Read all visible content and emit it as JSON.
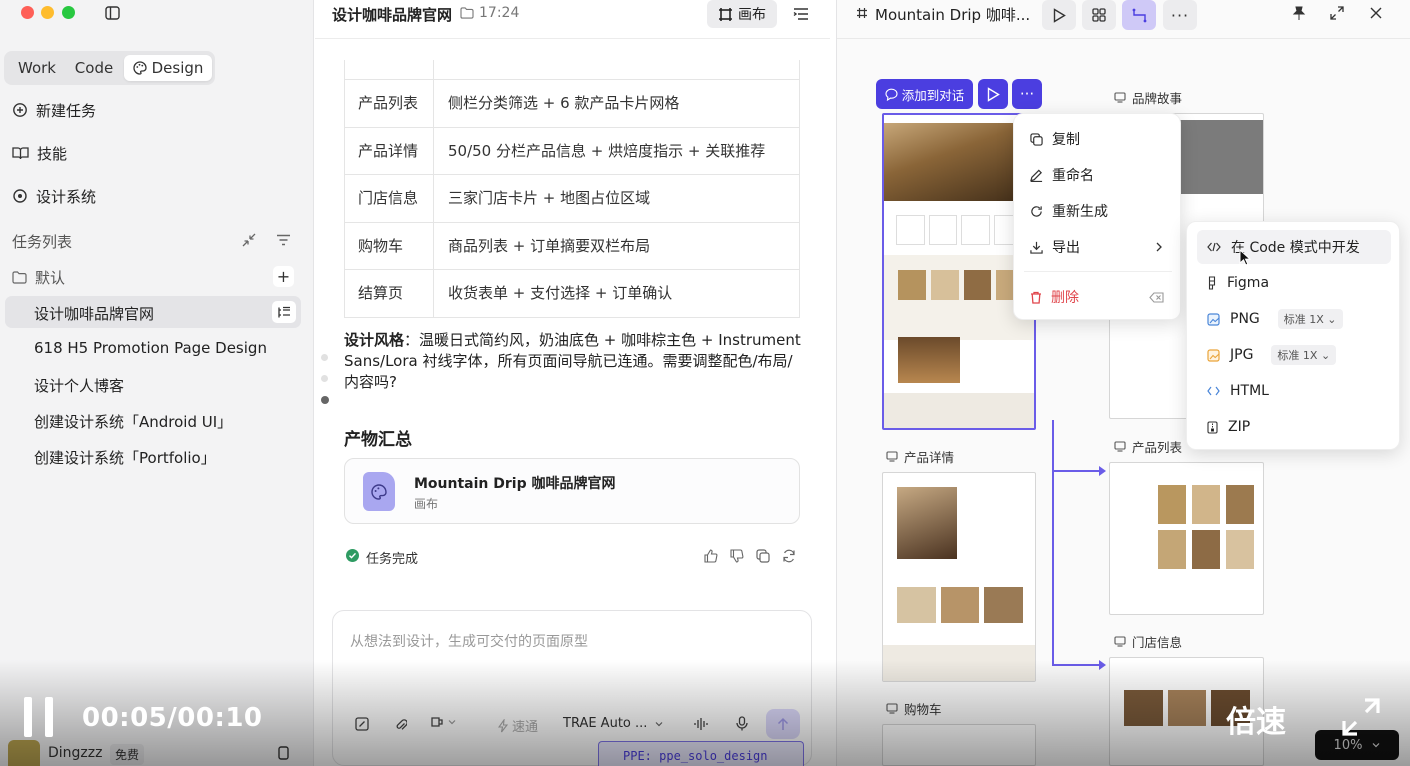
{
  "sidebar": {
    "tabs": [
      {
        "label": "Work"
      },
      {
        "label": "Code"
      },
      {
        "label": "Design"
      }
    ],
    "nav": [
      {
        "label": "新建任务",
        "icon": "new-task-icon"
      },
      {
        "label": "技能",
        "icon": "book-icon"
      },
      {
        "label": "设计系统",
        "icon": "design-system-icon"
      }
    ],
    "task_list_title": "任务列表",
    "group_label": "默认",
    "tasks": [
      "设计咖啡品牌官网",
      "618 H5 Promotion Page Design",
      "设计个人博客",
      "创建设计系统「Android UI」",
      "创建设计系统「Portfolio」"
    ],
    "user": {
      "name": "Dingzzz",
      "plan": "免费"
    }
  },
  "chat": {
    "title": "设计咖啡品牌官网",
    "time": "17:24",
    "canvas_toggle": "画布",
    "table_rows": [
      {
        "page": "产品列表",
        "desc": "侧栏分类筛选 + 6 款产品卡片网格"
      },
      {
        "page": "产品详情",
        "desc": "50/50 分栏产品信息 + 烘焙度指示 + 关联推荐"
      },
      {
        "page": "门店信息",
        "desc": "三家门店卡片 + 地图占位区域"
      },
      {
        "page": "购物车",
        "desc": "商品列表 + 订单摘要双栏布局"
      },
      {
        "page": "结算页",
        "desc": "收货表单 + 支付选择 + 订单确认"
      }
    ],
    "style_label": "设计风格",
    "style_line1": "：温暖日式简约风，奶油底色 + 咖啡棕主色 + Instrument",
    "style_line2": "Sans/Lora 衬线字体，所有页面间导航已连通。需要调整配色/布局/",
    "style_line3": "内容吗?",
    "artifacts_title": "产物汇总",
    "artifact": {
      "name": "Mountain Drip 咖啡品牌官网",
      "type": "画布"
    },
    "status": "任务完成",
    "input_placeholder": "从想法到设计，生成可交付的页面原型",
    "speed_label": "速通",
    "model_label": "TRAE Auto ...",
    "env_label": "PPE: ppe_solo_design"
  },
  "canvas": {
    "title": "Mountain Drip 咖啡...",
    "add_to_chat": "添加到对话",
    "labels": {
      "brand_story": "品牌故事",
      "product_detail": "产品详情",
      "product_list": "产品列表",
      "store_info": "门店信息",
      "cart": "购物车"
    },
    "context_menu": [
      {
        "label": "复制",
        "icon": "copy-icon"
      },
      {
        "label": "重命名",
        "icon": "rename-icon"
      },
      {
        "label": "重新生成",
        "icon": "regenerate-icon"
      },
      {
        "label": "导出",
        "icon": "export-icon"
      },
      {
        "label": "删除",
        "icon": "delete-icon"
      }
    ],
    "export_menu": [
      {
        "label": "在 Code 模式中开发",
        "icon": "code-icon"
      },
      {
        "label": "Figma",
        "icon": "figma-icon"
      },
      {
        "label": "PNG",
        "icon": "png-icon",
        "option": "标准 1X"
      },
      {
        "label": "JPG",
        "icon": "jpg-icon",
        "option": "标准 1X"
      },
      {
        "label": "HTML",
        "icon": "html-icon"
      },
      {
        "label": "ZIP",
        "icon": "zip-icon"
      }
    ],
    "zoom": "10%"
  },
  "video": {
    "time": "00:05/00:10",
    "speed": "倍速"
  },
  "colors": {
    "accent": "#4b3ee0",
    "danger": "#e0454b",
    "success": "#2e9b62",
    "connector": "#6a5ce8"
  }
}
